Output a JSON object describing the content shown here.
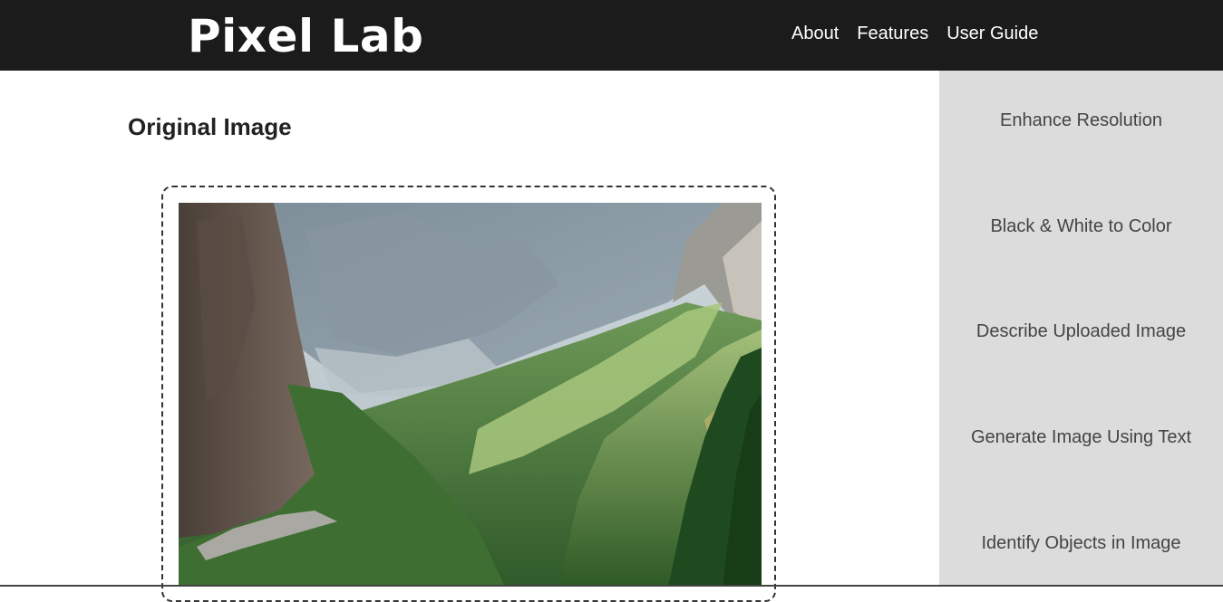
{
  "header": {
    "logo": "Pixel Lab",
    "nav": [
      "About",
      "Features",
      "User Guide"
    ]
  },
  "main": {
    "title": "Original Image",
    "image_description": "mountain-valley-photo"
  },
  "sidebar": {
    "items": [
      "Enhance Resolution",
      "Black & White to Color",
      "Describe Uploaded Image",
      "Generate Image Using Text",
      "Identify Objects in Image"
    ]
  },
  "colors": {
    "header_bg": "#1b1b1b",
    "sidebar_bg": "#dcdcdc",
    "text_dark": "#222222"
  }
}
